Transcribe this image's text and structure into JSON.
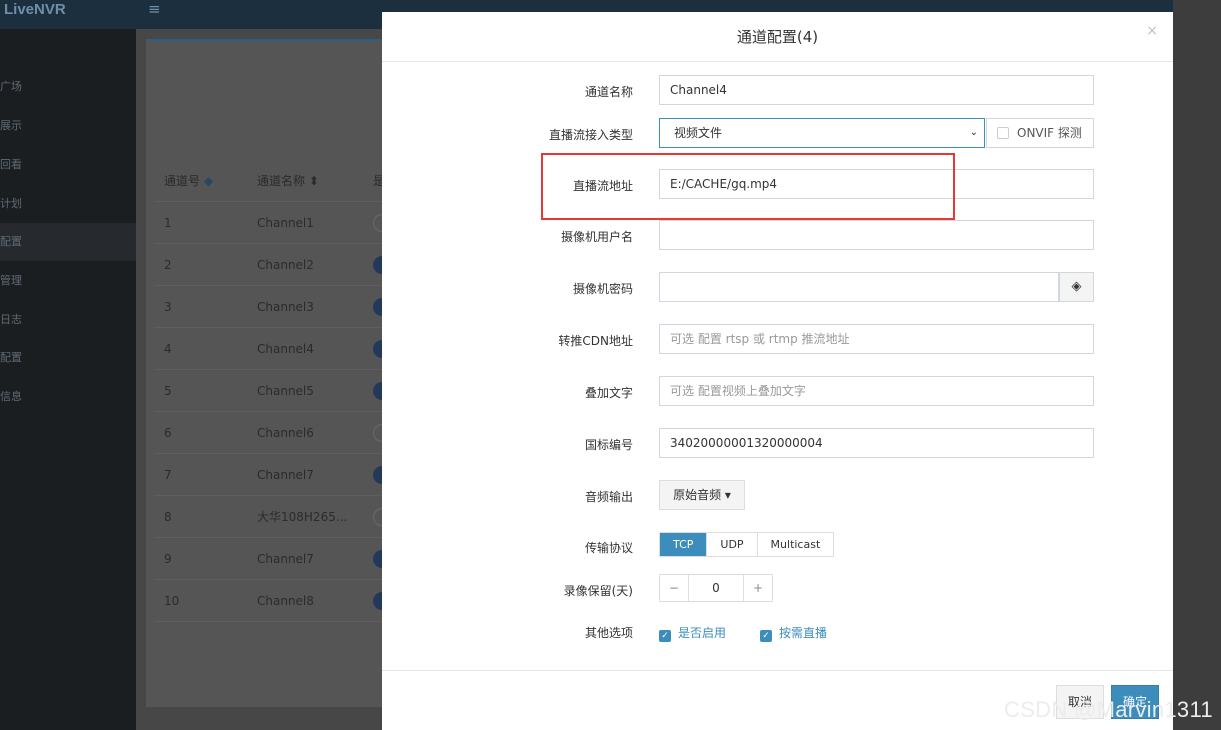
{
  "app": {
    "logo": "LiveNVR",
    "menu_icon": "≡"
  },
  "sidebar": {
    "items": [
      {
        "label": "广场"
      },
      {
        "label": "展示"
      },
      {
        "label": "回看"
      },
      {
        "label": "计划"
      },
      {
        "label": "配置",
        "active": true
      },
      {
        "label": "管理"
      },
      {
        "label": "日志"
      },
      {
        "label": "配置"
      },
      {
        "label": "信息"
      }
    ]
  },
  "table": {
    "headers": {
      "channel_no": "通道号",
      "channel_name": "通道名称",
      "col3": "是",
      "sort_icon": "◆",
      "sort_icon2": "⬍"
    },
    "rows": [
      {
        "no": "1",
        "name": "Channel1",
        "on": false
      },
      {
        "no": "2",
        "name": "Channel2",
        "on": true
      },
      {
        "no": "3",
        "name": "Channel3",
        "on": true
      },
      {
        "no": "4",
        "name": "Channel4",
        "on": true
      },
      {
        "no": "5",
        "name": "Channel5",
        "on": true
      },
      {
        "no": "6",
        "name": "Channel6",
        "on": false
      },
      {
        "no": "7",
        "name": "Channel7",
        "on": true
      },
      {
        "no": "8",
        "name": "大华108H265...",
        "on": false
      },
      {
        "no": "9",
        "name": "Channel7",
        "on": true
      },
      {
        "no": "10",
        "name": "Channel8",
        "on": true
      }
    ]
  },
  "modal": {
    "title": "通道配置(4)",
    "close": "×",
    "fields": {
      "channel_name": {
        "label": "通道名称",
        "value": "Channel4"
      },
      "stream_type": {
        "label": "直播流接入类型",
        "value": "视频文件",
        "arrow": "⌄"
      },
      "onvif": {
        "label": "ONVIF 探测",
        "checked": false
      },
      "stream_url": {
        "label": "直播流地址",
        "value": "E:/CACHE/gq.mp4"
      },
      "camera_user": {
        "label": "摄像机用户名",
        "value": ""
      },
      "camera_password": {
        "label": "摄像机密码",
        "value": "",
        "eye_icon": "◈"
      },
      "cdn_url": {
        "label": "转推CDN地址",
        "placeholder": "可选 配置 rtsp 或 rtmp 推流地址"
      },
      "overlay_text": {
        "label": "叠加文字",
        "placeholder": "可选 配置视频上叠加文字"
      },
      "gb_code": {
        "label": "国标编号",
        "value": "34020000001320000004"
      },
      "audio_output": {
        "label": "音频输出",
        "value": "原始音频 ▾"
      },
      "transport": {
        "label": "传输协议",
        "options": [
          "TCP",
          "UDP",
          "Multicast"
        ],
        "selected": "TCP"
      },
      "record_days": {
        "label": "录像保留(天)",
        "minus": "−",
        "value": "0",
        "plus": "+"
      },
      "other": {
        "label": "其他选项",
        "enabled": "是否启用",
        "on_demand": "按需直播",
        "check": "✓"
      }
    },
    "buttons": {
      "cancel": "取消",
      "ok": "确定"
    }
  },
  "watermark": "CSDN @Marvin1311",
  "colors": {
    "primary": "#3c8dbc",
    "highlight": "#e53935",
    "topbar": "#1c2f3f",
    "sidebar": "#1b1e21"
  }
}
